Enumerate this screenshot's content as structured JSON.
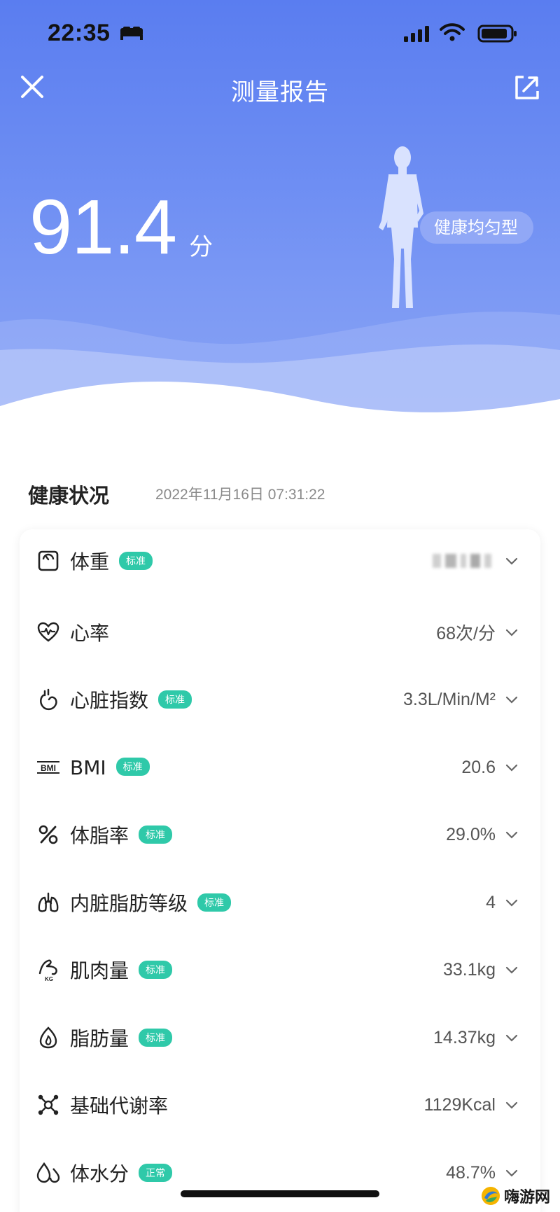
{
  "status_bar": {
    "time": "22:35"
  },
  "header": {
    "title": "测量报告"
  },
  "score": {
    "value": "91.4",
    "unit": "分"
  },
  "body_type": "健康均匀型",
  "health": {
    "title": "健康状况",
    "date": "2022年11月16日 07:31:22"
  },
  "metrics": [
    {
      "label": "体重",
      "badge": "标准",
      "value": "",
      "icon": "scale-icon"
    },
    {
      "label": "心率",
      "badge": "",
      "value": "68次/分",
      "icon": "heart-rate-icon"
    },
    {
      "label": "心脏指数",
      "badge": "标准",
      "value": "3.3L/Min/M²",
      "icon": "heart-icon"
    },
    {
      "label": "BMI",
      "badge": "标准",
      "value": "20.6",
      "icon": "bmi-icon"
    },
    {
      "label": "体脂率",
      "badge": "标准",
      "value": "29.0%",
      "icon": "percent-icon"
    },
    {
      "label": "内脏脂肪等级",
      "badge": "标准",
      "value": "4",
      "icon": "lungs-icon"
    },
    {
      "label": "肌肉量",
      "badge": "标准",
      "value": "33.1kg",
      "icon": "muscle-icon"
    },
    {
      "label": "脂肪量",
      "badge": "标准",
      "value": "14.37kg",
      "icon": "flame-icon"
    },
    {
      "label": "基础代谢率",
      "badge": "",
      "value": "1129Kcal",
      "icon": "molecule-icon"
    },
    {
      "label": "体水分",
      "badge": "正常",
      "value": "48.7%",
      "icon": "water-drops-icon"
    }
  ],
  "watermark": "嗨游网",
  "colors": {
    "hero_blue": "#5a7df0",
    "badge_green": "#2fc9a9"
  }
}
